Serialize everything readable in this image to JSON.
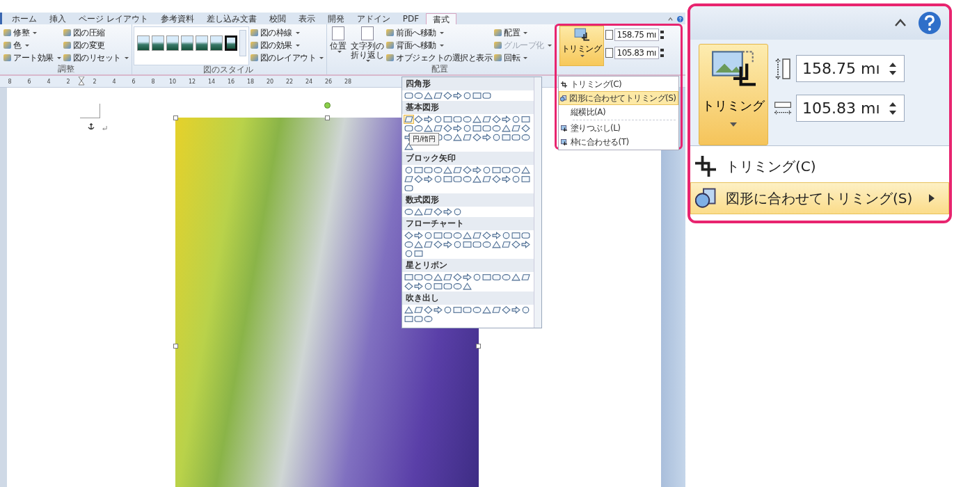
{
  "ribbon": {
    "tabs": [
      {
        "label": "ホーム",
        "selected": false
      },
      {
        "label": "挿入",
        "selected": false
      },
      {
        "label": "ページ レイアウト",
        "selected": false
      },
      {
        "label": "参考資料",
        "selected": false
      },
      {
        "label": "差し込み文書",
        "selected": false
      },
      {
        "label": "校閲",
        "selected": false
      },
      {
        "label": "表示",
        "selected": false
      },
      {
        "label": "開発",
        "selected": false
      },
      {
        "label": "アドイン",
        "selected": false
      },
      {
        "label": "PDF",
        "selected": false
      },
      {
        "label": "書式",
        "selected": true
      }
    ],
    "adjust": {
      "label": "調整",
      "items": [
        {
          "label": "修整",
          "dropdown": true
        },
        {
          "label": "色",
          "dropdown": true
        },
        {
          "label": "アート効果",
          "dropdown": true
        },
        {
          "label": "図の圧縮",
          "dropdown": false
        },
        {
          "label": "図の変更",
          "dropdown": false
        },
        {
          "label": "図のリセット",
          "dropdown": true
        }
      ]
    },
    "styles": {
      "label": "図のスタイル",
      "items": [
        {
          "label": "図の枠線",
          "dropdown": true
        },
        {
          "label": "図の効果",
          "dropdown": true
        },
        {
          "label": "図のレイアウト",
          "dropdown": true
        }
      ]
    },
    "arrange": {
      "label": "配置",
      "large": [
        {
          "label": "位置",
          "dropdown": true
        },
        {
          "label": "文字列の折り返し",
          "dropdown": true
        }
      ],
      "small": [
        {
          "label": "前面へ移動",
          "dropdown": true,
          "disabled": false
        },
        {
          "label": "背面へ移動",
          "dropdown": true,
          "disabled": false
        },
        {
          "label": "オブジェクトの選択と表示",
          "dropdown": false,
          "disabled": false
        },
        {
          "label": "配置",
          "dropdown": true,
          "disabled": false
        },
        {
          "label": "グループ化",
          "dropdown": true,
          "disabled": true
        },
        {
          "label": "回転",
          "dropdown": true,
          "disabled": false
        }
      ]
    },
    "size": {
      "crop_button": "トリミング",
      "height": "158.75 mı",
      "width": "105.83 mı"
    }
  },
  "ruler_labels": [
    "8",
    "6",
    "4",
    "2",
    "2",
    "4",
    "6",
    "8",
    "10",
    "12",
    "14",
    "16",
    "18",
    "20",
    "22",
    "24",
    "26",
    "28"
  ],
  "shape_gallery": {
    "tooltip": "円/楕円",
    "sections": [
      {
        "title": "四角形"
      },
      {
        "title": "基本図形"
      },
      {
        "title": "ブロック矢印"
      },
      {
        "title": "数式図形"
      },
      {
        "title": "フローチャート"
      },
      {
        "title": "星とリボン"
      },
      {
        "title": "吹き出し"
      }
    ]
  },
  "crop_menu": [
    {
      "label": "トリミング(C)",
      "kind": "crop",
      "highlighted": false,
      "submenu": false
    },
    {
      "label": "図形に合わせてトリミング(S)",
      "kind": "shape",
      "highlighted": true,
      "submenu": false
    },
    {
      "label": "縦横比(A)",
      "kind": "aspect",
      "highlighted": false,
      "submenu": false
    },
    {
      "label": "塗りつぶし(L)",
      "kind": "fill",
      "highlighted": false,
      "submenu": false
    },
    {
      "label": "枠に合わせる(T)",
      "kind": "fit",
      "highlighted": false,
      "submenu": false
    }
  ],
  "zoom_callout": {
    "crop_button": "トリミング",
    "height": "158.75 mı",
    "width": "105.83 mı",
    "menu": [
      {
        "label": "トリミング(C)",
        "kind": "crop",
        "highlighted": false,
        "submenu": false
      },
      {
        "label": "図形に合わせてトリミング(S)",
        "kind": "shape",
        "highlighted": true,
        "submenu": true
      }
    ]
  }
}
